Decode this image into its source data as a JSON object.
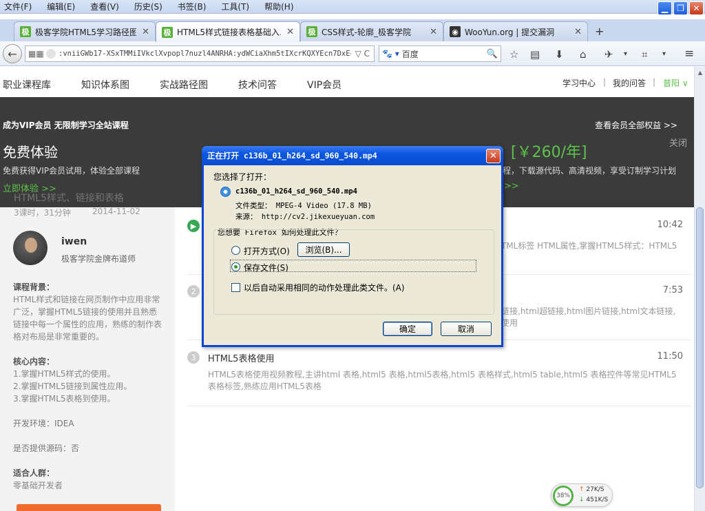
{
  "menubar": {
    "items": [
      "文件(F)",
      "编辑(E)",
      "查看(V)",
      "历史(S)",
      "书签(B)",
      "工具(T)",
      "帮助(H)"
    ]
  },
  "window_buttons": {
    "minimize": "▁",
    "restore": "❐",
    "close": "✕"
  },
  "tabs": [
    {
      "icon": "极",
      "label": "极客学院HTML5学习路径图",
      "close": "✕"
    },
    {
      "icon": "极",
      "label": "HTML5样式链接表格基础入…",
      "close": "✕",
      "active": true
    },
    {
      "icon": "极",
      "label": "CSS样式-轮廓_极客学院",
      "close": "✕"
    },
    {
      "icon": "◉",
      "label": "WooYun.org | 提交漏洞",
      "close": "✕"
    }
  ],
  "new_tab": "+",
  "navbar": {
    "back": "←",
    "url": ":vniiGWb17-XSxTMMiIVkclXvpopl7nuzl4ANRHA:ydWCiaXhm5tIXcrKQXYEcn7DxEc=",
    "url_tail": "▽ C",
    "search_engine": "🐾 ▾",
    "search_text": "百度",
    "search_icon": "🔍",
    "toolbar_icons": [
      "☆",
      "▤",
      "⬇",
      "⌂",
      "✈",
      "▾",
      "⌗",
      "▾",
      "≡"
    ]
  },
  "site_nav": {
    "left": [
      "职业课程库",
      "知识体系图",
      "实战路径图",
      "技术问答",
      "VIP会员"
    ],
    "right": [
      "学习中心",
      "我的问答",
      "普阳 ∨"
    ],
    "sep": "|"
  },
  "vip_banner": {
    "top_left": "成为VIP会员 无限制学习全站课程",
    "top_right": "查看会员全部权益 >>",
    "headline": "免费体验",
    "sub": "免费获得VIP会员试用，体验全部课程",
    "cta": "立即体验 >>",
    "price": "[￥260/年]",
    "sub2": "程，下载源代码、高清视频，享受订制学习计划",
    "cta2": ">>",
    "close": "关闭"
  },
  "course": {
    "title": "HTML5样式、链接和表格",
    "meta": "3课时，31分钟",
    "date": "2014-11-02"
  },
  "teacher": {
    "name": "iwen",
    "role": "极客学院金牌布道师"
  },
  "sidebar": {
    "bg_label": "课程背景：",
    "bg_text": "HTML样式和链接在网页制作中应用非常广泛，掌握HTML5链接的使用并且熟悉链接中每一个属性的应用，熟练的制作表格对布局是非常重要的。",
    "core_label": "核心内容：",
    "core_items": [
      "1.掌握HTML5样式的使用。",
      "2.掌握HTML5链接到属性应用。",
      "3.掌握HTML5表格到使用。"
    ],
    "env": "开发环境：IDEA",
    "source": "是否提供源码：否",
    "audience_label": "适合人群：",
    "audience": "零基础开发者"
  },
  "lessons": [
    {
      "num": "▶",
      "title": "",
      "duration": "10:42",
      "desc": "TML标签 HTML属性,掌握HTML5样式：HTML5"
    },
    {
      "num": "2",
      "title": "",
      "duration": "7:53",
      "desc": "链接,html超链接,html图片链接,html文本链接,\n使用"
    },
    {
      "num": "3",
      "title": "HTML5表格使用",
      "duration": "11:50",
      "desc": "HTML5表格使用视频教程,主讲html 表格,html5 表格,html5表格,html5 表格样式,html5 table,html5 表格控件等常见HTML5表格标签,熟练应用HTML5表格"
    }
  ],
  "speed": {
    "percent": "38%",
    "up": "27K/S",
    "down": "451K/S",
    "up_arrow": "↑",
    "down_arrow": "↓"
  },
  "dialog": {
    "title": "正在打开 c136b_01_h264_sd_960_540.mp4",
    "close": "✕",
    "chosen_label": "您选择了打开：",
    "filename": "c136b_01_h264_sd_960_540.mp4",
    "filetype": "文件类型： MPEG-4 Video (17.8 MB)",
    "source": "来源： http://cv2.jikexueyuan.com",
    "question": "您想要 Firefox 如何处理此文件？",
    "open_with": "打开方式(O)",
    "browse": "浏览(B)...",
    "save_file": "保存文件(S)",
    "auto": "以后自动采用相同的动作处理此类文件。(A)",
    "ok": "确定",
    "cancel": "取消"
  }
}
